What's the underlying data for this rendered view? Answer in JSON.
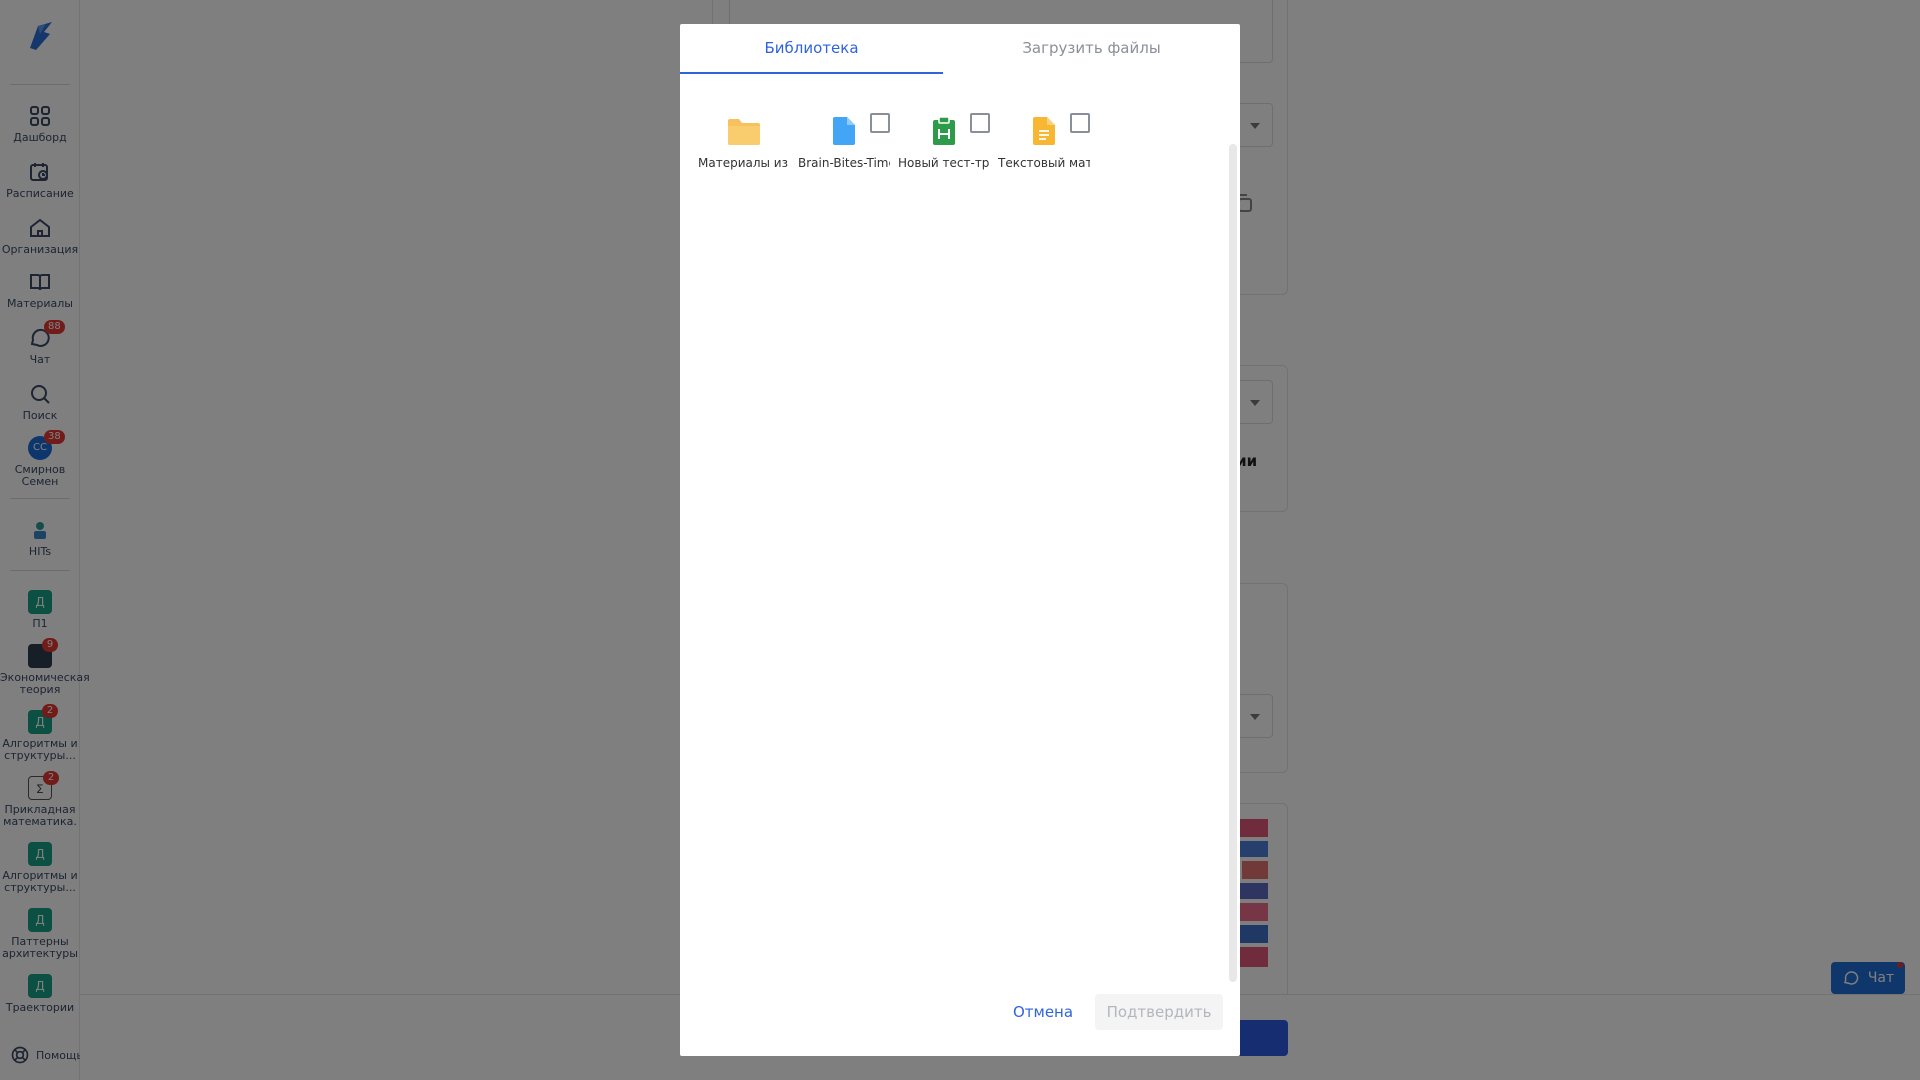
{
  "sidebar": {
    "items": [
      {
        "label": "Дашборд",
        "icon": "grid-icon"
      },
      {
        "label": "Расписание",
        "icon": "calendar-clock-icon"
      },
      {
        "label": "Организация",
        "icon": "home-icon"
      },
      {
        "label": "Материалы",
        "icon": "book-icon"
      },
      {
        "label": "Чат",
        "icon": "chat-icon",
        "badge": "88"
      },
      {
        "label": "Поиск",
        "icon": "search-icon"
      },
      {
        "label": "Смирнов Семен",
        "icon": "avatar",
        "avatar_text": "СС",
        "badge": "38"
      },
      {
        "label": "HITs",
        "icon": "hits-icon"
      },
      {
        "label": "П1",
        "icon": "course-icon",
        "square": "Д"
      },
      {
        "label": "Экономическая теория",
        "icon": "course-icon",
        "badge": "9"
      },
      {
        "label": "Алгоритмы и структуры...",
        "icon": "course-icon",
        "square": "Д",
        "badge": "2"
      },
      {
        "label": "Прикладная математика.",
        "icon": "course-icon",
        "badge": "2"
      },
      {
        "label": "Алгоритмы и структуры...",
        "icon": "course-icon",
        "square": "Д"
      },
      {
        "label": "Паттерны архитектуры",
        "icon": "course-icon",
        "square": "Д"
      },
      {
        "label": "Траектории",
        "icon": "course-icon",
        "square": "Д"
      }
    ],
    "help_label": "Помощь"
  },
  "background": {
    "visible_text": "ции",
    "chat_button": "Чат"
  },
  "modal": {
    "tabs": [
      {
        "label": "Библиотека",
        "active": true
      },
      {
        "label": "Загрузить файлы",
        "active": false
      }
    ],
    "items": [
      {
        "name": "Материалы из курса",
        "icon": "folder-icon",
        "color": "#f7c15d",
        "selectable": false
      },
      {
        "name": "Brain-Bites-Time",
        "icon": "file-icon",
        "color": "#42a5f5",
        "selectable": true
      },
      {
        "name": "Новый тест-тренажер",
        "icon": "test-icon",
        "color": "#2e9b4a",
        "selectable": true
      },
      {
        "name": "Текстовый материал",
        "icon": "text-doc-icon",
        "color": "#f7b733",
        "selectable": true
      }
    ],
    "cancel_label": "Отмена",
    "confirm_label": "Подтвердить"
  },
  "colors": {
    "accent": "#2f64de",
    "overlay": "rgba(0,0,0,0.5)"
  }
}
